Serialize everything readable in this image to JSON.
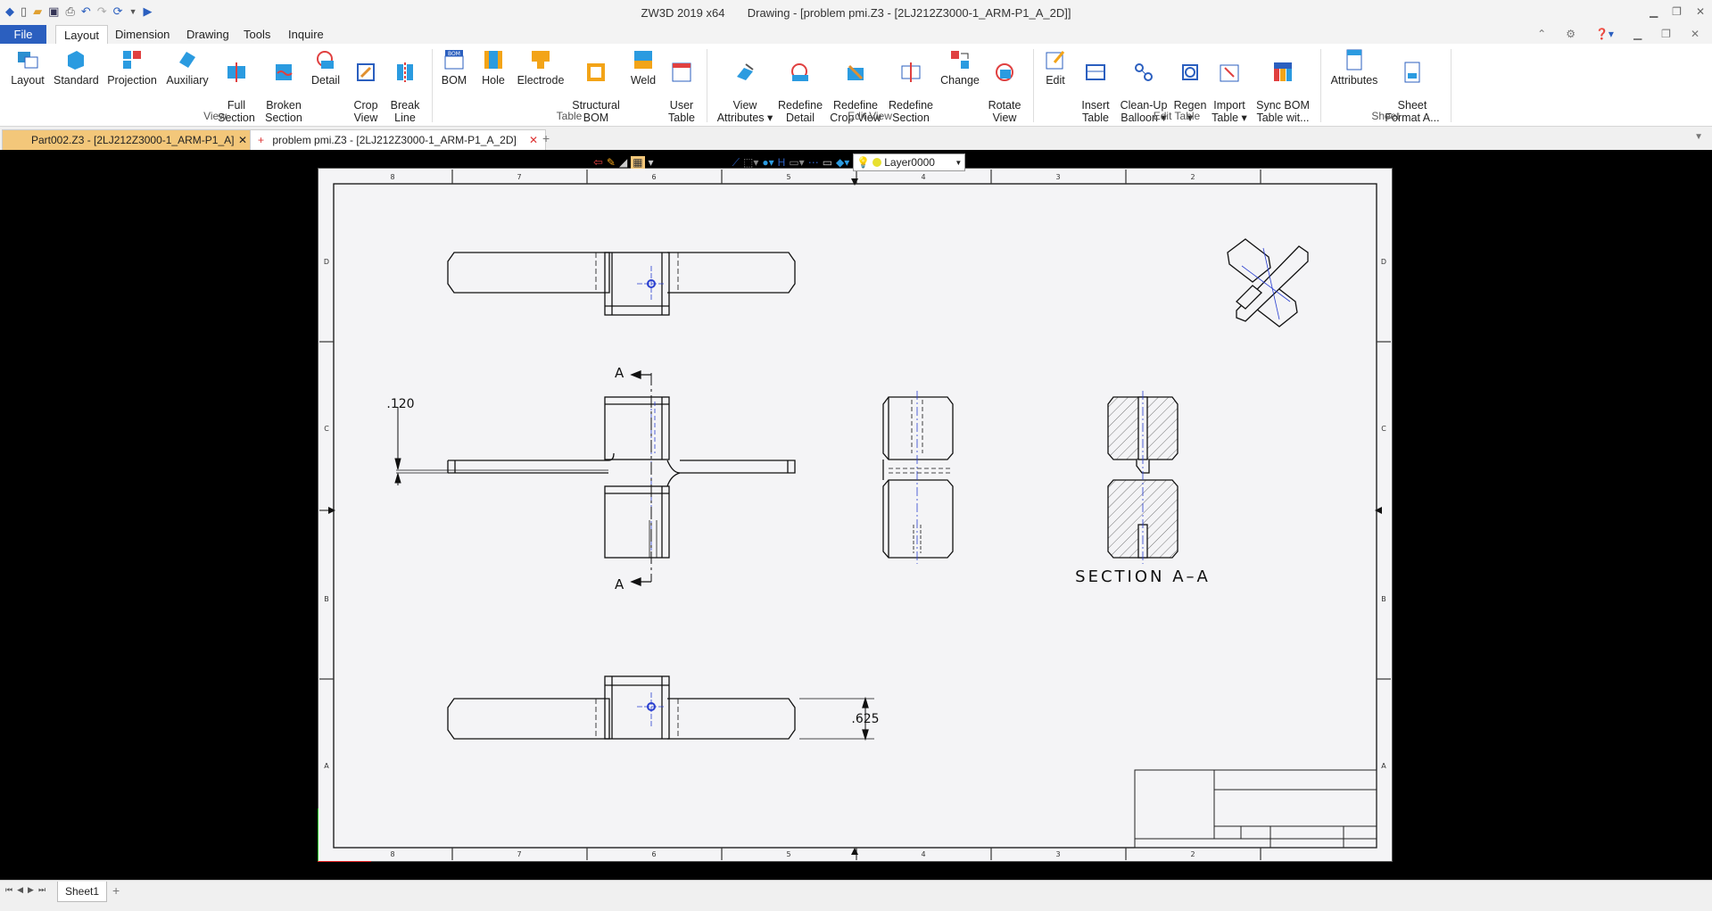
{
  "window": {
    "app_name": "ZW3D 2019  x64",
    "doc_title": "Drawing - [problem pmi.Z3 - [2LJ212Z3000-1_ARM-P1_A_2D]]"
  },
  "menu": {
    "file": "File",
    "tabs": [
      "Layout",
      "Dimension",
      "Drawing",
      "Tools",
      "Inquire"
    ]
  },
  "ribbon": {
    "view": {
      "group": "View",
      "buttons": [
        "Layout",
        "Standard",
        "Projection",
        "Auxiliary",
        "Full\nSection ▾",
        "Broken\nSection",
        "Detail",
        "Crop\nView",
        "Break\nLine"
      ]
    },
    "table": {
      "group": "Table",
      "buttons": [
        "BOM",
        "Hole",
        "Electrode",
        "Structural\nBOM",
        "Weld",
        "User\nTable"
      ]
    },
    "edit_view": {
      "group": "Edit View",
      "buttons": [
        "View\nAttributes ▾",
        "Redefine\nDetail",
        "Redefine\nCrop View",
        "Redefine\nSection",
        "Change",
        "Rotate\nView"
      ]
    },
    "edit_table": {
      "group": "Edit Table",
      "buttons": [
        "Edit",
        "Insert\nTable",
        "Clean-Up\nBalloon ▾",
        "Regen\n▾",
        "Import\nTable ▾",
        "Sync BOM\nTable wit..."
      ]
    },
    "sheet": {
      "group": "Sheet",
      "buttons": [
        "Attributes",
        "Sheet\nFormat A..."
      ]
    },
    "bom_badge": "BOM"
  },
  "doc_tabs": [
    {
      "label": "Part002.Z3 - [2LJ212Z3000-1_ARM-P1_A]",
      "active": false
    },
    {
      "label": "problem pmi.Z3 - [2LJ212Z3000-1_ARM-P1_A_2D]",
      "active": true
    }
  ],
  "view_toolbar": {
    "layer": "Layer0000"
  },
  "drawing": {
    "zone_cols": [
      "8",
      "7",
      "6",
      "5",
      "4",
      "3",
      "2"
    ],
    "zone_rows": [
      "D",
      "C",
      "B",
      "A"
    ],
    "dim_120": ".120",
    "dim_625": ".625",
    "section_label": "A",
    "section_title": "SECTION  A–A"
  },
  "sheet_tab": "Sheet1",
  "colors": {
    "ribbon_blue": "#2b5fbf",
    "accent_orange": "#f3a418",
    "canvas": "#000000",
    "sheet": "#f4f4f6",
    "line": "#222222",
    "center_blue": "#2a3fd0"
  }
}
